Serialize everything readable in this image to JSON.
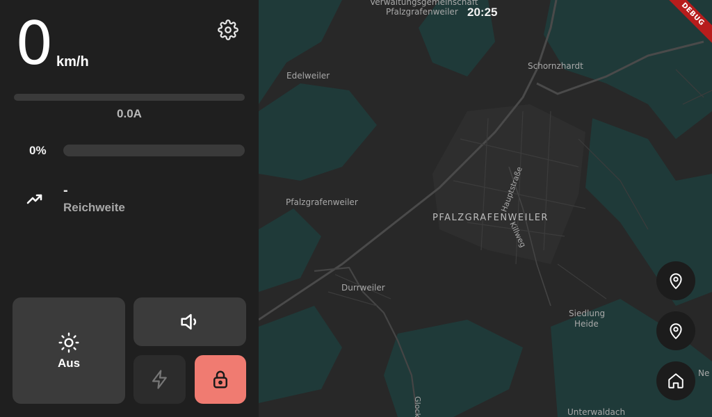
{
  "dashboard": {
    "speed_value": "0",
    "speed_unit": "km/h",
    "current_label": "0.0A",
    "current_level": 0,
    "battery_label": "0%",
    "battery_level": 0,
    "range_value": "-",
    "range_label": "Reichweite",
    "light_label": "Aus"
  },
  "icons": {
    "settings": "gear-icon",
    "range": "trending-up-icon",
    "light": "sun-icon",
    "horn": "volume-icon",
    "boost": "lightning-icon",
    "lock": "lock-icon",
    "pin": "map-pin-icon",
    "home": "home-icon"
  },
  "map": {
    "clock": "20:25",
    "banner": "DEBUG",
    "labels": {
      "verwaltung_1": "Verwaltungsgemeinschaft",
      "verwaltung_2": "Pfalzgrafenweiler",
      "edelweiler": "Edelweiler",
      "schornzhardt": "Schornzhardt",
      "pfalzgrafenweiler_small": "Pfalzgrafenweiler",
      "town": "PFALZGRAFENWEILER",
      "hauptstrasse": "Hauptstraße",
      "killweg": "Killweg",
      "durrweiler": "Durrweiler",
      "siedlung": "Siedlung",
      "heide": "Heide",
      "unterwaldach": "Unterwaldach",
      "glock": "Glock",
      "ne": "Ne"
    }
  },
  "colors": {
    "panel": "#1f1f1f",
    "tile": "#3b3b3b",
    "lock_accent": "#f07b71",
    "map_forest": "#1f3a39",
    "map_land": "#282828",
    "debug": "#b71c1c"
  }
}
